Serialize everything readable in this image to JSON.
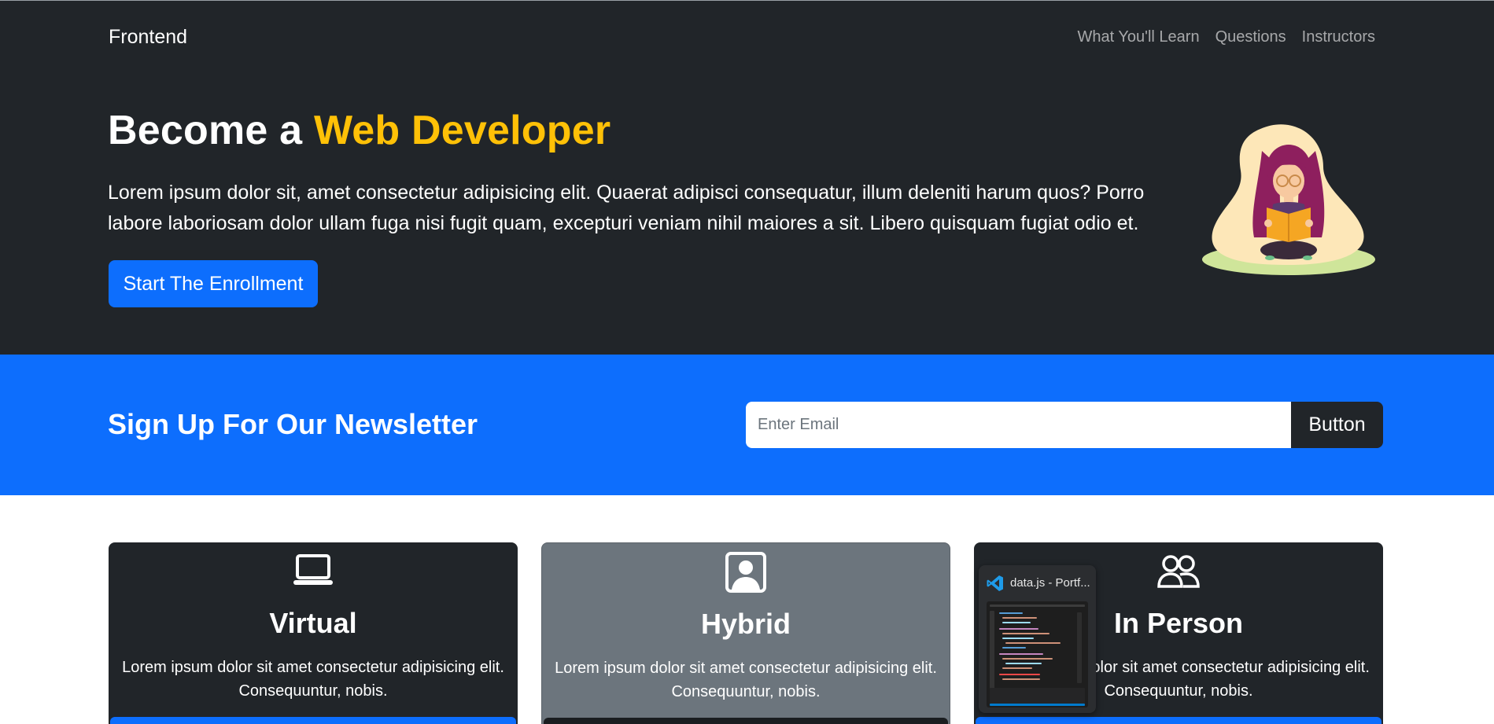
{
  "nav": {
    "brand": "Frontend",
    "links": [
      "What You'll Learn",
      "Questions",
      "Instructors"
    ]
  },
  "hero": {
    "title_prefix": "Become a ",
    "title_accent": "Web Developer",
    "text": "Lorem ipsum dolor sit, amet consectetur adipisicing elit. Quaerat adipisci consequatur, illum deleniti harum quos? Porro labore laboriosam dolor ullam fuga nisi fugit quam, excepturi veniam nihil maiores a sit. Libero quisquam fugiat odio et.",
    "button": "Start The Enrollment",
    "illustration_icon": "girl-reading-book-illustration"
  },
  "newsletter": {
    "title": "Sign Up For Our Newsletter",
    "email_placeholder": "Enter Email",
    "button": "Button"
  },
  "cards": [
    {
      "title": "Virtual",
      "text": "Lorem ipsum dolor sit amet consectetur adipisicing elit. Consequuntur, nobis.",
      "icon": "laptop-icon"
    },
    {
      "title": "Hybrid",
      "text": "Lorem ipsum dolor sit amet consectetur adipisicing elit. Consequuntur, nobis.",
      "icon": "person-square-icon"
    },
    {
      "title": "In Person",
      "text": "Lorem ipsum dolor sit amet consectetur adipisicing elit. Consequuntur, nobis.",
      "icon": "people-icon"
    }
  ],
  "taskbar_preview": {
    "title": "data.js - Portf...",
    "icon": "vscode-icon"
  },
  "colors": {
    "dark": "#212529",
    "primary": "#0d6efd",
    "warning": "#ffc107",
    "secondary": "#6c757d"
  }
}
